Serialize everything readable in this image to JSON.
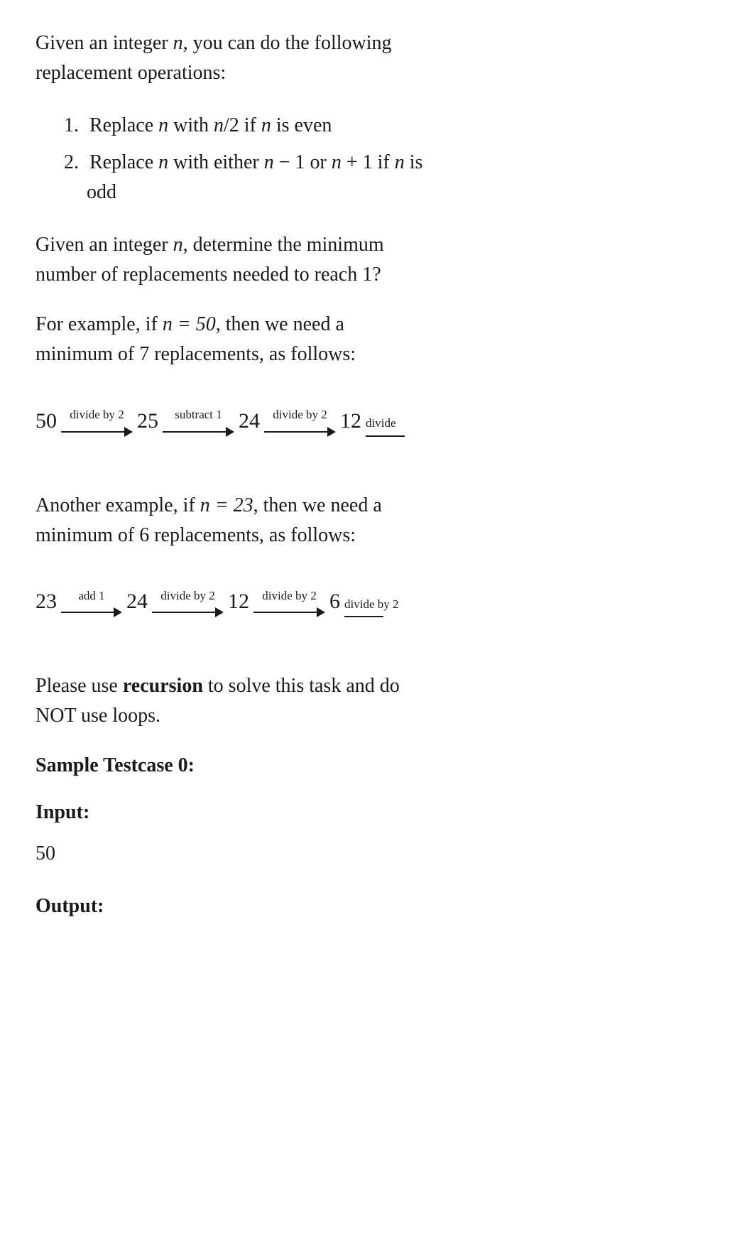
{
  "intro": {
    "line1": "Given an integer ",
    "var_n": "n",
    "line1_cont": ", you can do the following",
    "line2": "replacement operations:"
  },
  "operations": [
    {
      "num": "1.",
      "text_before": "Replace ",
      "var1": "n",
      "text_mid": " with ",
      "expr": "n/2",
      "text_after": " if ",
      "var2": "n",
      "text_end": " is even"
    },
    {
      "num": "2.",
      "text_before": "Replace ",
      "var1": "n",
      "text_mid": " with either ",
      "expr1": "n − 1",
      "text_or": " or ",
      "expr2": "n + 1",
      "text_after": " if ",
      "var2": "n",
      "text_end": " is"
    },
    {
      "continuation": "odd"
    }
  ],
  "question": {
    "line1": "Given an integer ",
    "var_n": "n",
    "line1_cont": ", determine the minimum",
    "line2": "number of replacements needed to reach 1?"
  },
  "example1": {
    "intro": "For example, if ",
    "var_n": "n",
    "eq": " = 50",
    "cont": ", then we need a",
    "line2": "minimum of 7 replacements, as follows:"
  },
  "diagram1": {
    "steps": [
      {
        "value": "50",
        "label": "divide by 2"
      },
      {
        "value": "25",
        "label": "subtract 1"
      },
      {
        "value": "24",
        "label": "divide by 2"
      },
      {
        "value": "12",
        "label": "divide"
      }
    ]
  },
  "example2": {
    "intro": "Another example, if ",
    "var_n": "n",
    "eq": " = 23",
    "cont": ", then we need a",
    "line2": "minimum of 6 replacements, as follows:"
  },
  "diagram2": {
    "steps": [
      {
        "value": "23",
        "label": "add 1"
      },
      {
        "value": "24",
        "label": "divide by 2"
      },
      {
        "value": "12",
        "label": "divide by 2"
      },
      {
        "value": "6",
        "label": "divide by 2"
      }
    ]
  },
  "please_use": {
    "before": "Please use ",
    "bold": "recursion",
    "after": " to solve this task and do",
    "line2": "NOT use loops."
  },
  "sample_testcase": {
    "heading": "Sample Testcase 0:"
  },
  "input_section": {
    "heading": "Input:",
    "value": "50"
  },
  "output_section": {
    "heading": "Output:"
  }
}
